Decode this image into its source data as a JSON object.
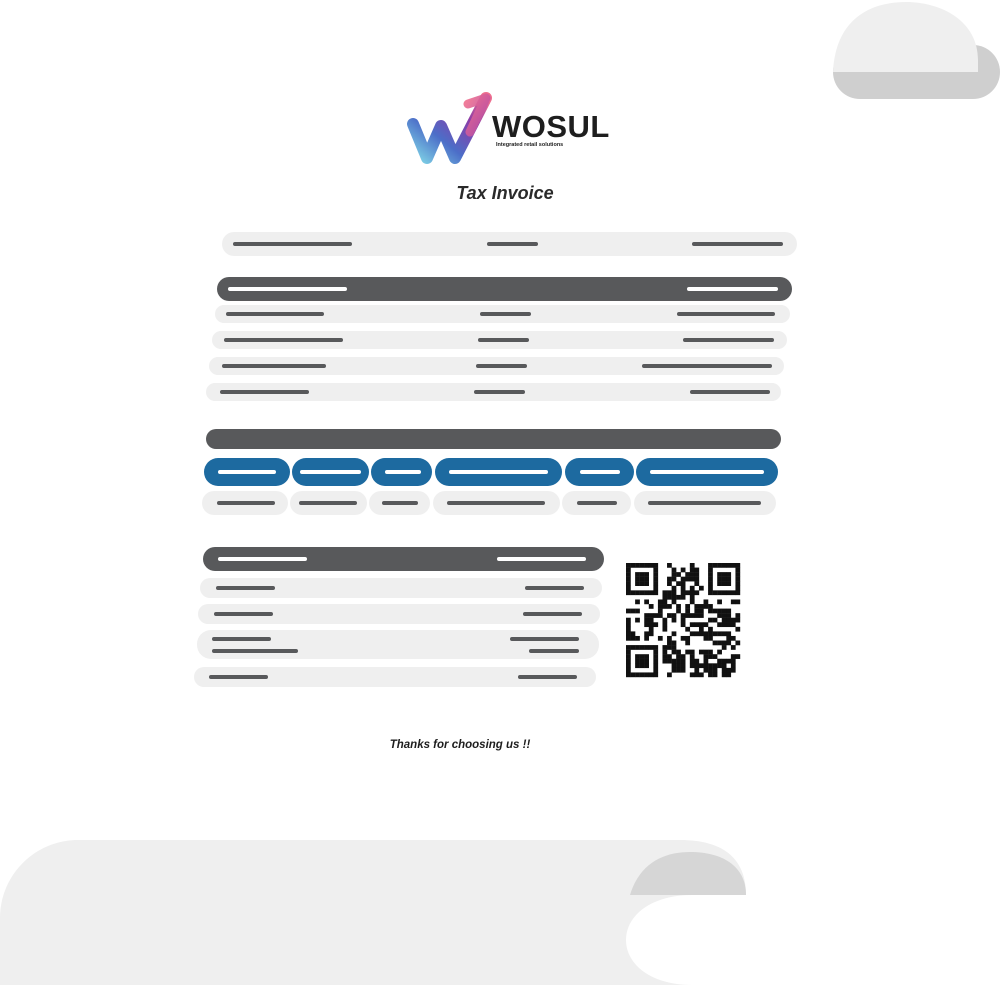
{
  "brand": {
    "name": "WOSUL",
    "tagline": "Integrated retail solutions",
    "logo_icon": "wosul-w-logo-icon",
    "colors": {
      "pink": "#ee6e8e",
      "purple": "#8a3ca8",
      "blue": "#4c6ec8",
      "cyan": "#7fd3e6"
    }
  },
  "invoice": {
    "title": "Tax Invoice"
  },
  "footer": {
    "thanks": "Thanks for choosing us !!"
  },
  "qr": {
    "icon": "qr-code-icon"
  },
  "colors": {
    "row_light": "#efefef",
    "header_dark": "#58595b",
    "items_header_blue": "#1d6aa0",
    "placeholder_line": "#58595b",
    "curl_light": "#efefef",
    "curl_mid": "#cfcfcf"
  }
}
